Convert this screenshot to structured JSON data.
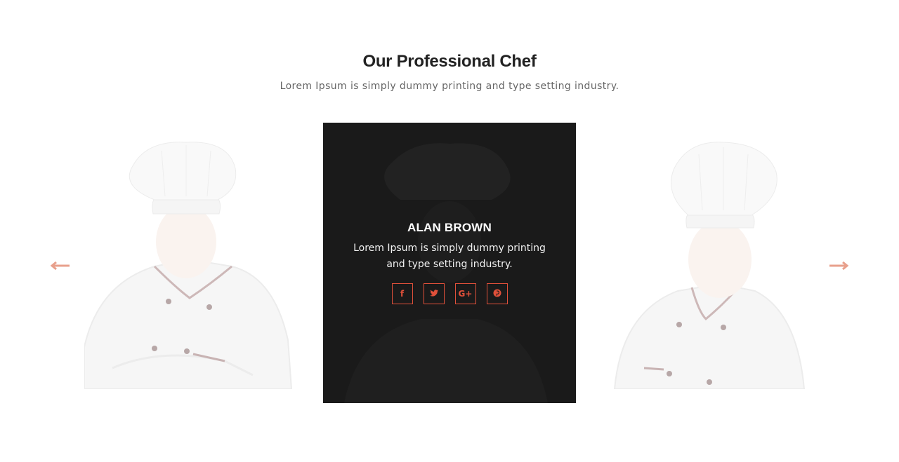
{
  "header": {
    "title": "Our Professional Chef",
    "subtitle": "Lorem Ipsum is simply dummy printing and type setting industry."
  },
  "carousel": {
    "prev_icon": "arrow-left-icon",
    "next_icon": "arrow-right-icon",
    "arrow_color": "#e8a08c",
    "featured": {
      "name": "ALAN BROWN",
      "description": "Lorem Ipsum is simply dummy printing and type setting industry.",
      "socials": [
        {
          "icon": "facebook-icon",
          "glyph": "f"
        },
        {
          "icon": "twitter-icon",
          "glyph": "t"
        },
        {
          "icon": "google-plus-icon",
          "glyph": "G+"
        },
        {
          "icon": "pinterest-icon",
          "glyph": "p"
        }
      ]
    }
  },
  "colors": {
    "accent": "#e0503a",
    "card_overlay": "#1a1a1a",
    "title": "#222222",
    "subtitle": "#666666"
  }
}
